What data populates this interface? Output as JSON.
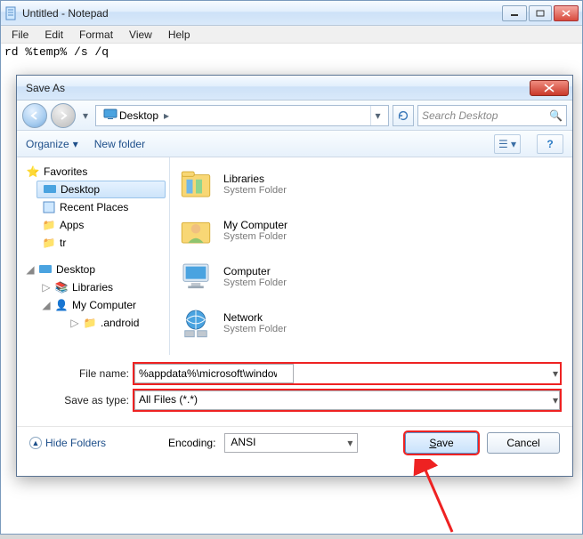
{
  "notepad": {
    "title": "Untitled - Notepad",
    "menu": {
      "file": "File",
      "edit": "Edit",
      "format": "Format",
      "view": "View",
      "help": "Help"
    },
    "content": "rd %temp% /s /q"
  },
  "saveas": {
    "title": "Save As",
    "nav": {
      "desktop_label": "Desktop",
      "search_placeholder": "Search Desktop"
    },
    "toolbar": {
      "organize": "Organize",
      "newfolder": "New folder"
    },
    "tree": {
      "favorites": "Favorites",
      "desktop": "Desktop",
      "recent": "Recent Places",
      "apps": "Apps",
      "tr": "tr",
      "libs": "Libraries",
      "mycomp": "My Computer",
      "android": ".android"
    },
    "list": {
      "libraries": {
        "name": "Libraries",
        "kind": "System Folder"
      },
      "mycomputer": {
        "name": "My Computer",
        "kind": "System Folder"
      },
      "computer": {
        "name": "Computer",
        "kind": "System Folder"
      },
      "network": {
        "name": "Network",
        "kind": "System Folder"
      }
    },
    "fields": {
      "filename_label": "File name:",
      "filename_value": "%appdata%\\microsoft\\windows\\start menu\\programs\\startup\\cleantemp.bat",
      "savetype_label": "Save as type:",
      "savetype_value": "All Files (*.*)",
      "encoding_label": "Encoding:",
      "encoding_value": "ANSI"
    },
    "buttons": {
      "hidefolders": "Hide Folders",
      "save": "Save",
      "cancel": "Cancel"
    }
  }
}
